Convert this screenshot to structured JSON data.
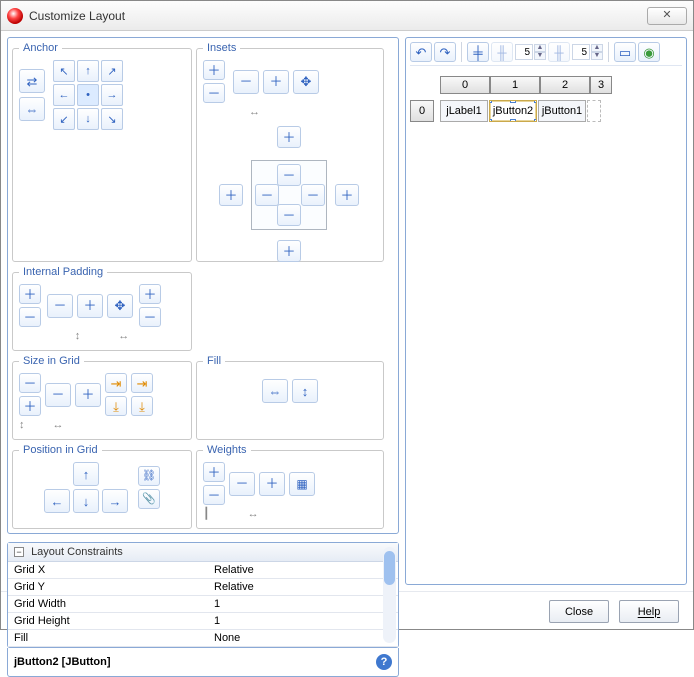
{
  "window": {
    "title": "Customize Layout",
    "close_glyph": "✕"
  },
  "groups": {
    "anchor": "Anchor",
    "insets": "Insets",
    "internal_padding": "Internal Padding",
    "size_in_grid": "Size in Grid",
    "fill": "Fill",
    "position_in_grid": "Position in Grid",
    "weights": "Weights"
  },
  "constraints": {
    "header": "Layout Constraints",
    "rows": [
      {
        "key": "Grid X",
        "value": "Relative"
      },
      {
        "key": "Grid Y",
        "value": "Relative"
      },
      {
        "key": "Grid Width",
        "value": "1"
      },
      {
        "key": "Grid Height",
        "value": "1"
      },
      {
        "key": "Fill",
        "value": "None"
      }
    ]
  },
  "status": {
    "selection": "jButton2 [JButton]"
  },
  "toolbar": {
    "undo": "↶",
    "redo": "↷",
    "pad_h_enabled": "╪",
    "pad_h_disabled": "╫",
    "spin1": "5",
    "spin2": "5",
    "test": "▭",
    "preview": "◉"
  },
  "grid": {
    "columns": [
      "0",
      "1",
      "2",
      "3"
    ],
    "row_header": "0",
    "cells": [
      {
        "label": "jLabel1",
        "selected": false
      },
      {
        "label": "jButton2",
        "selected": true
      },
      {
        "label": "jButton1",
        "selected": false
      }
    ]
  },
  "buttons": {
    "close": "Close",
    "help": "Help"
  },
  "glyphs": {
    "plus": "＋",
    "minus": "－",
    "arrow_l": "←",
    "arrow_r": "→",
    "arrow_u": "↑",
    "arrow_d": "↓",
    "arrow_lr": "↔",
    "arrow_ud": "↕",
    "move": "✥",
    "cycle": "⇄",
    "biarrow": "⇔",
    "nw": "↖",
    "ne": "↗",
    "sw": "↙",
    "se": "↘",
    "link": "⛓",
    "attach": "📎",
    "dot": "•",
    "grid": "▦",
    "yline": "┃",
    "xline": "━",
    "expand_r": "⇥",
    "expand_d": "⤓"
  }
}
